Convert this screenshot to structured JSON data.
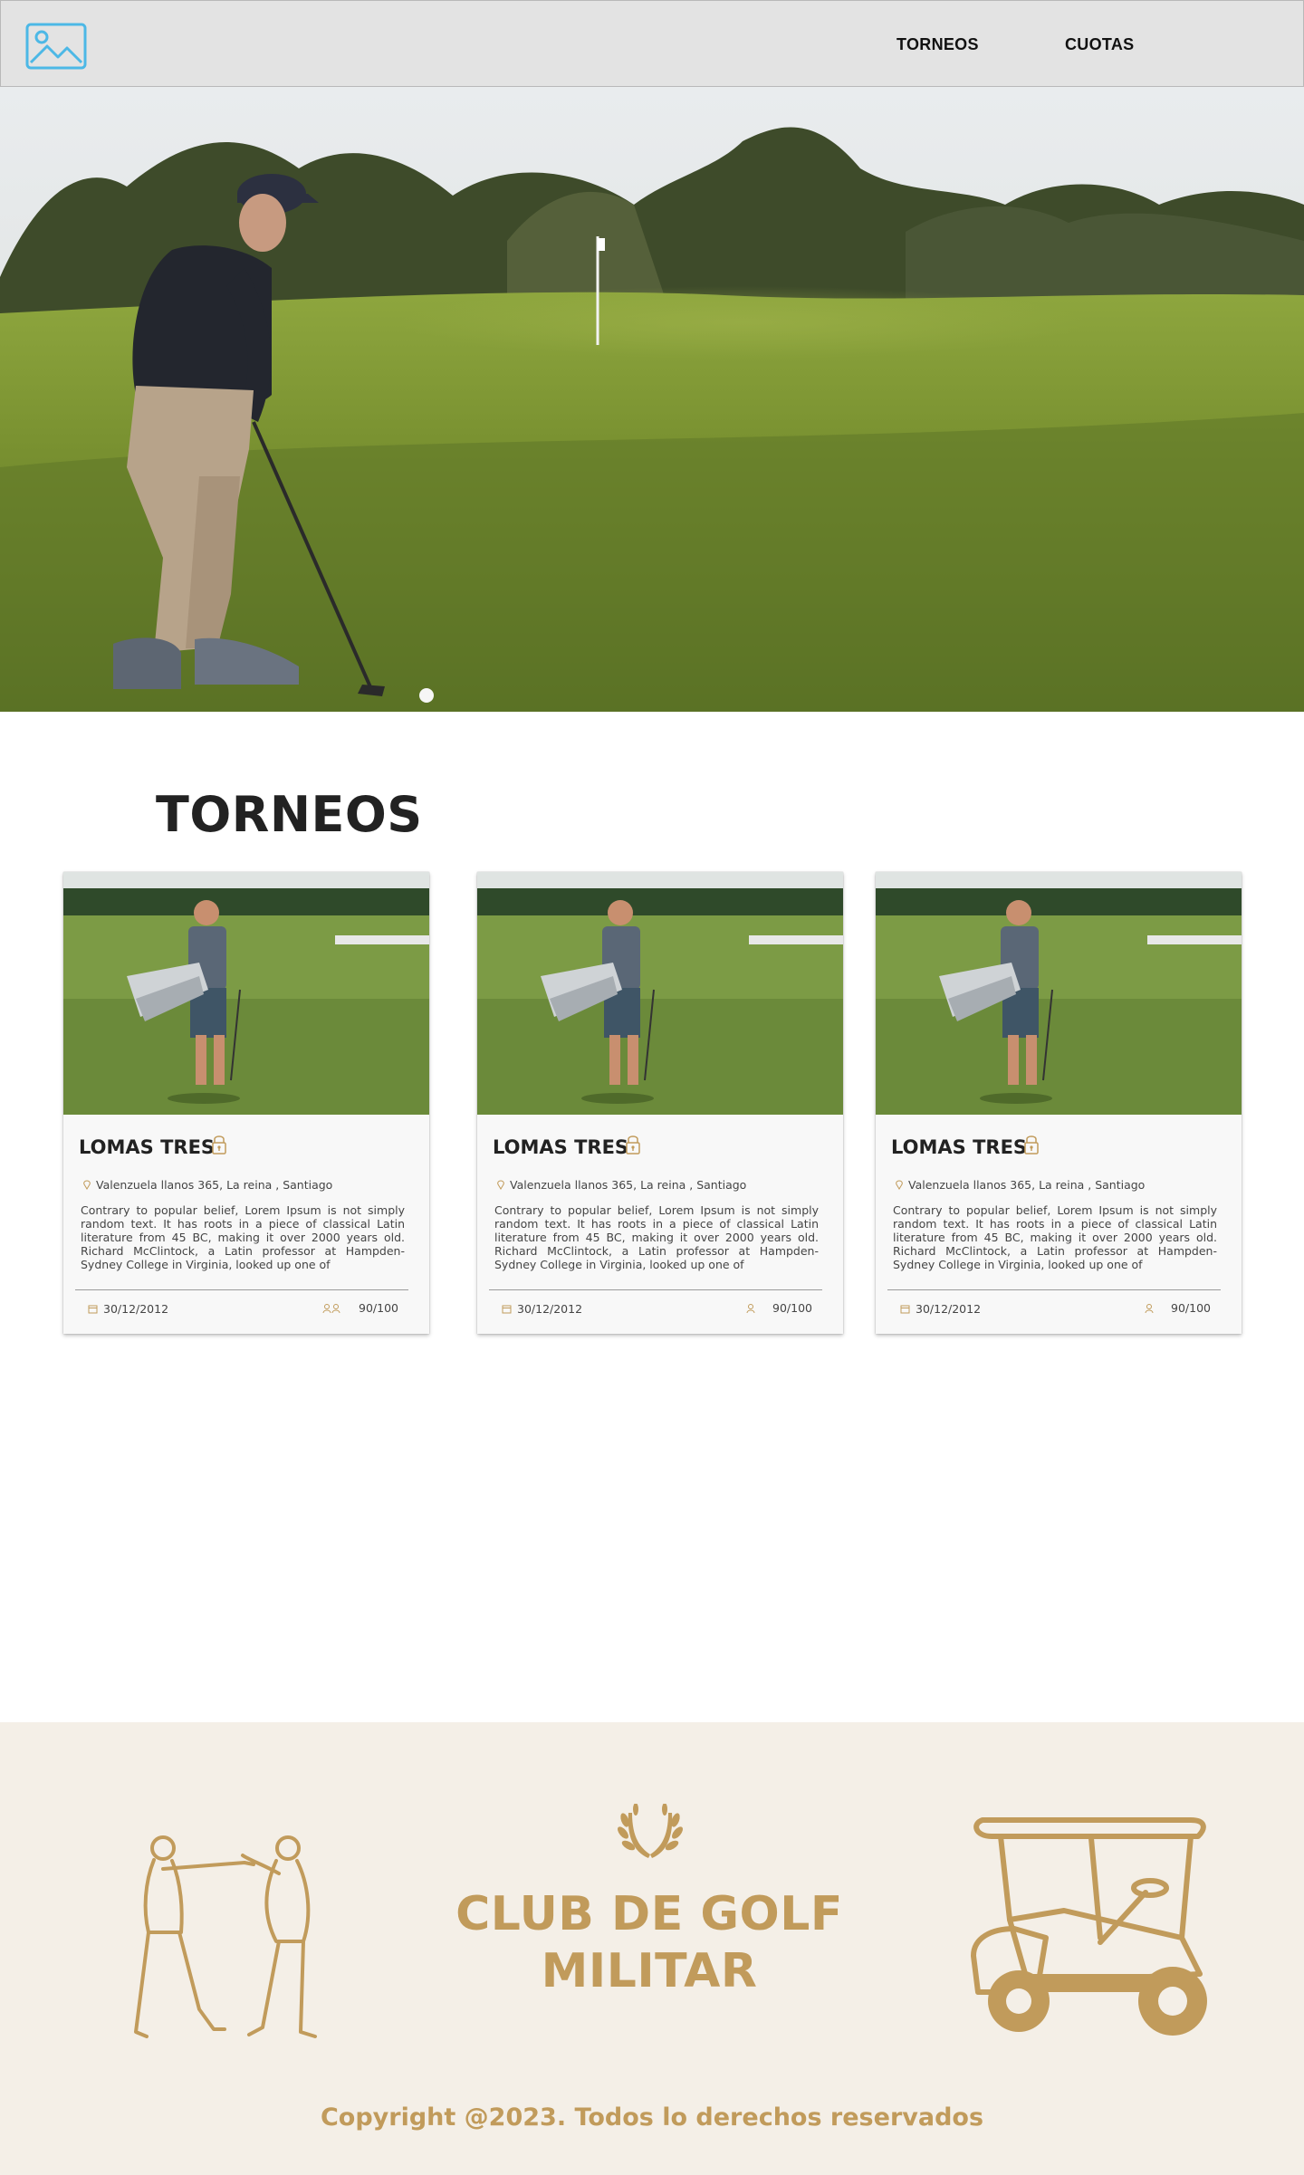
{
  "header": {
    "nav": [
      {
        "label": "TORNEOS"
      },
      {
        "label": "CUOTAS"
      }
    ]
  },
  "main": {
    "section_title": "TORNEOS",
    "cards": [
      {
        "title": "LOMAS TRES",
        "address": "Valenzuela llanos 365, La reina , Santiago",
        "description": "Contrary to popular belief, Lorem Ipsum is not simply random text. It has roots in a piece of classical Latin literature from 45 BC, making it over 2000 years old. Richard McClintock, a Latin professor at Hampden-Sydney College in Virginia, looked up one of",
        "date": "30/12/2012",
        "capacity": "90/100"
      },
      {
        "title": "LOMAS TRES",
        "address": "Valenzuela llanos 365, La reina , Santiago",
        "description": "Contrary to popular belief, Lorem Ipsum is not simply random text. It has roots in a piece of classical Latin literature from 45 BC, making it over 2000 years old. Richard McClintock, a Latin professor at Hampden-Sydney College in Virginia, looked up one of",
        "date": "30/12/2012",
        "capacity": "90/100"
      },
      {
        "title": "LOMAS TRES",
        "address": "Valenzuela llanos 365, La reina , Santiago",
        "description": "Contrary to popular belief, Lorem Ipsum is not simply random text. It has roots in a piece of classical Latin literature from 45 BC, making it over 2000 years old. Richard McClintock, a Latin professor at Hampden-Sydney College in Virginia, looked up one of",
        "date": "30/12/2012",
        "capacity": "90/100"
      }
    ]
  },
  "footer": {
    "club_name": "CLUB DE GOLF MILITAR",
    "copyright": "Copyright @2023. Todos lo derechos reservados"
  },
  "icons": {
    "logo": "image-placeholder-icon",
    "lock": "lock-icon",
    "location": "location-pin-icon",
    "calendar": "calendar-icon",
    "capacity": "user-icon",
    "laurel": "laurel-icon",
    "golfers": "golfers-illustration",
    "cart": "golf-cart-illustration"
  },
  "colors": {
    "header_bg": "#e3e3e3",
    "accent_gold": "#c19b5b",
    "footer_bg": "#f4efe7",
    "logo_blue": "#4cb8e6"
  }
}
